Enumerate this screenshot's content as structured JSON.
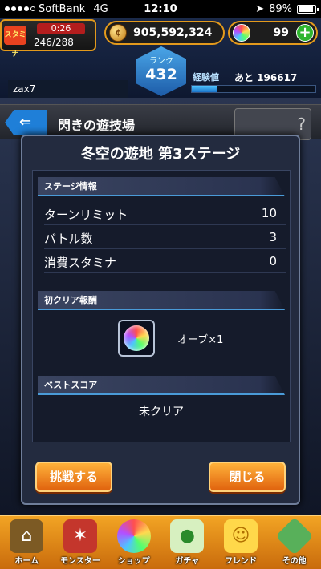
{
  "status_bar": {
    "carrier": "SoftBank",
    "network": "4G",
    "time": "12:10",
    "battery": "89%",
    "battery_level": 0.89
  },
  "hud": {
    "stamina_label": "スタミナ",
    "stamina_timer": "0:26",
    "stamina_count": "246/288",
    "coins": "905,592,324",
    "orbs": "99",
    "plus": "+",
    "rank_label": "ランク",
    "rank_value": "432",
    "username": "zax7",
    "exp_label": "経験値",
    "exp_remaining": "あと 196617",
    "exp_progress": 0.2
  },
  "nav": {
    "back_arrow": "⇐",
    "area_title": "閃きの遊技場",
    "thumb_text": "?"
  },
  "modal": {
    "title": "冬空の遊地 第3ステージ",
    "stage_info_header": "ステージ情報",
    "rows": [
      {
        "label": "ターンリミット",
        "value": "10"
      },
      {
        "label": "バトル数",
        "value": "3"
      },
      {
        "label": "消費スタミナ",
        "value": "0"
      }
    ],
    "first_clear_header": "初クリア報酬",
    "reward_label": "オーブ×1",
    "best_score_header": "ベストスコア",
    "best_score_value": "未クリア",
    "challenge_button": "挑戦する",
    "close_button": "閉じる"
  },
  "tabs": [
    {
      "label": "ホーム",
      "icon": "home-icon"
    },
    {
      "label": "モンスター",
      "icon": "monster-icon"
    },
    {
      "label": "ショップ",
      "icon": "shop-icon"
    },
    {
      "label": "ガチャ",
      "icon": "gacha-icon"
    },
    {
      "label": "フレンド",
      "icon": "friend-icon"
    },
    {
      "label": "その他",
      "icon": "other-icon"
    }
  ]
}
